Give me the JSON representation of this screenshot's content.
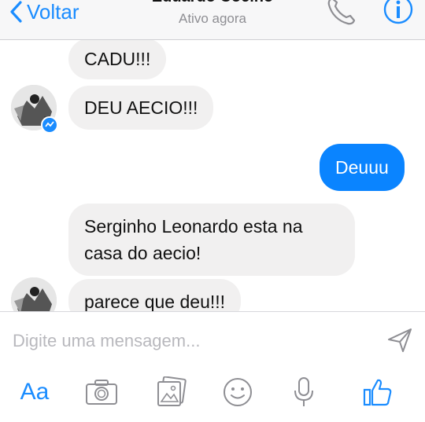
{
  "header": {
    "back_label": "Voltar",
    "title": "Eduardo Cocino",
    "status": "Ativo agora"
  },
  "messages": [
    {
      "direction": "in",
      "text": "CADU!!!"
    },
    {
      "direction": "in",
      "text": "DEU AECIO!!!"
    },
    {
      "direction": "out",
      "text": "Deuuu"
    },
    {
      "direction": "in",
      "text_line1": "Serginho Leonardo esta na",
      "text_line2": "casa do aecio!"
    },
    {
      "direction": "in",
      "text": "parece que deu!!!"
    }
  ],
  "composer": {
    "placeholder": "Digite uma mensagem...",
    "aa_label": "Aa"
  },
  "colors": {
    "accent": "#1a8cff",
    "outgoing_bubble": "#0a84ff",
    "incoming_bubble": "#f1f0f0"
  }
}
